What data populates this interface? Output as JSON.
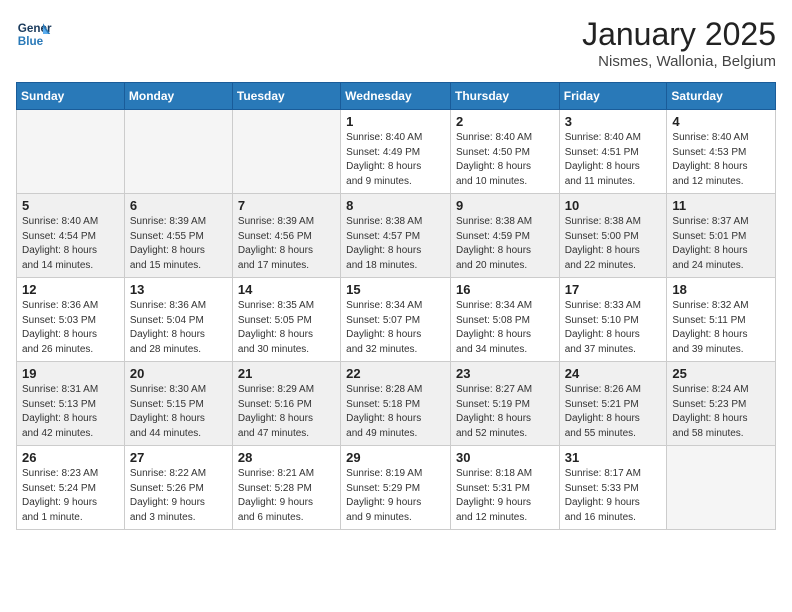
{
  "header": {
    "logo_general": "General",
    "logo_blue": "Blue",
    "month_title": "January 2025",
    "location": "Nismes, Wallonia, Belgium"
  },
  "days_of_week": [
    "Sunday",
    "Monday",
    "Tuesday",
    "Wednesday",
    "Thursday",
    "Friday",
    "Saturday"
  ],
  "weeks": [
    {
      "shaded": false,
      "days": [
        {
          "number": "",
          "info": ""
        },
        {
          "number": "",
          "info": ""
        },
        {
          "number": "",
          "info": ""
        },
        {
          "number": "1",
          "info": "Sunrise: 8:40 AM\nSunset: 4:49 PM\nDaylight: 8 hours\nand 9 minutes."
        },
        {
          "number": "2",
          "info": "Sunrise: 8:40 AM\nSunset: 4:50 PM\nDaylight: 8 hours\nand 10 minutes."
        },
        {
          "number": "3",
          "info": "Sunrise: 8:40 AM\nSunset: 4:51 PM\nDaylight: 8 hours\nand 11 minutes."
        },
        {
          "number": "4",
          "info": "Sunrise: 8:40 AM\nSunset: 4:53 PM\nDaylight: 8 hours\nand 12 minutes."
        }
      ]
    },
    {
      "shaded": true,
      "days": [
        {
          "number": "5",
          "info": "Sunrise: 8:40 AM\nSunset: 4:54 PM\nDaylight: 8 hours\nand 14 minutes."
        },
        {
          "number": "6",
          "info": "Sunrise: 8:39 AM\nSunset: 4:55 PM\nDaylight: 8 hours\nand 15 minutes."
        },
        {
          "number": "7",
          "info": "Sunrise: 8:39 AM\nSunset: 4:56 PM\nDaylight: 8 hours\nand 17 minutes."
        },
        {
          "number": "8",
          "info": "Sunrise: 8:38 AM\nSunset: 4:57 PM\nDaylight: 8 hours\nand 18 minutes."
        },
        {
          "number": "9",
          "info": "Sunrise: 8:38 AM\nSunset: 4:59 PM\nDaylight: 8 hours\nand 20 minutes."
        },
        {
          "number": "10",
          "info": "Sunrise: 8:38 AM\nSunset: 5:00 PM\nDaylight: 8 hours\nand 22 minutes."
        },
        {
          "number": "11",
          "info": "Sunrise: 8:37 AM\nSunset: 5:01 PM\nDaylight: 8 hours\nand 24 minutes."
        }
      ]
    },
    {
      "shaded": false,
      "days": [
        {
          "number": "12",
          "info": "Sunrise: 8:36 AM\nSunset: 5:03 PM\nDaylight: 8 hours\nand 26 minutes."
        },
        {
          "number": "13",
          "info": "Sunrise: 8:36 AM\nSunset: 5:04 PM\nDaylight: 8 hours\nand 28 minutes."
        },
        {
          "number": "14",
          "info": "Sunrise: 8:35 AM\nSunset: 5:05 PM\nDaylight: 8 hours\nand 30 minutes."
        },
        {
          "number": "15",
          "info": "Sunrise: 8:34 AM\nSunset: 5:07 PM\nDaylight: 8 hours\nand 32 minutes."
        },
        {
          "number": "16",
          "info": "Sunrise: 8:34 AM\nSunset: 5:08 PM\nDaylight: 8 hours\nand 34 minutes."
        },
        {
          "number": "17",
          "info": "Sunrise: 8:33 AM\nSunset: 5:10 PM\nDaylight: 8 hours\nand 37 minutes."
        },
        {
          "number": "18",
          "info": "Sunrise: 8:32 AM\nSunset: 5:11 PM\nDaylight: 8 hours\nand 39 minutes."
        }
      ]
    },
    {
      "shaded": true,
      "days": [
        {
          "number": "19",
          "info": "Sunrise: 8:31 AM\nSunset: 5:13 PM\nDaylight: 8 hours\nand 42 minutes."
        },
        {
          "number": "20",
          "info": "Sunrise: 8:30 AM\nSunset: 5:15 PM\nDaylight: 8 hours\nand 44 minutes."
        },
        {
          "number": "21",
          "info": "Sunrise: 8:29 AM\nSunset: 5:16 PM\nDaylight: 8 hours\nand 47 minutes."
        },
        {
          "number": "22",
          "info": "Sunrise: 8:28 AM\nSunset: 5:18 PM\nDaylight: 8 hours\nand 49 minutes."
        },
        {
          "number": "23",
          "info": "Sunrise: 8:27 AM\nSunset: 5:19 PM\nDaylight: 8 hours\nand 52 minutes."
        },
        {
          "number": "24",
          "info": "Sunrise: 8:26 AM\nSunset: 5:21 PM\nDaylight: 8 hours\nand 55 minutes."
        },
        {
          "number": "25",
          "info": "Sunrise: 8:24 AM\nSunset: 5:23 PM\nDaylight: 8 hours\nand 58 minutes."
        }
      ]
    },
    {
      "shaded": false,
      "days": [
        {
          "number": "26",
          "info": "Sunrise: 8:23 AM\nSunset: 5:24 PM\nDaylight: 9 hours\nand 1 minute."
        },
        {
          "number": "27",
          "info": "Sunrise: 8:22 AM\nSunset: 5:26 PM\nDaylight: 9 hours\nand 3 minutes."
        },
        {
          "number": "28",
          "info": "Sunrise: 8:21 AM\nSunset: 5:28 PM\nDaylight: 9 hours\nand 6 minutes."
        },
        {
          "number": "29",
          "info": "Sunrise: 8:19 AM\nSunset: 5:29 PM\nDaylight: 9 hours\nand 9 minutes."
        },
        {
          "number": "30",
          "info": "Sunrise: 8:18 AM\nSunset: 5:31 PM\nDaylight: 9 hours\nand 12 minutes."
        },
        {
          "number": "31",
          "info": "Sunrise: 8:17 AM\nSunset: 5:33 PM\nDaylight: 9 hours\nand 16 minutes."
        },
        {
          "number": "",
          "info": ""
        }
      ]
    }
  ]
}
